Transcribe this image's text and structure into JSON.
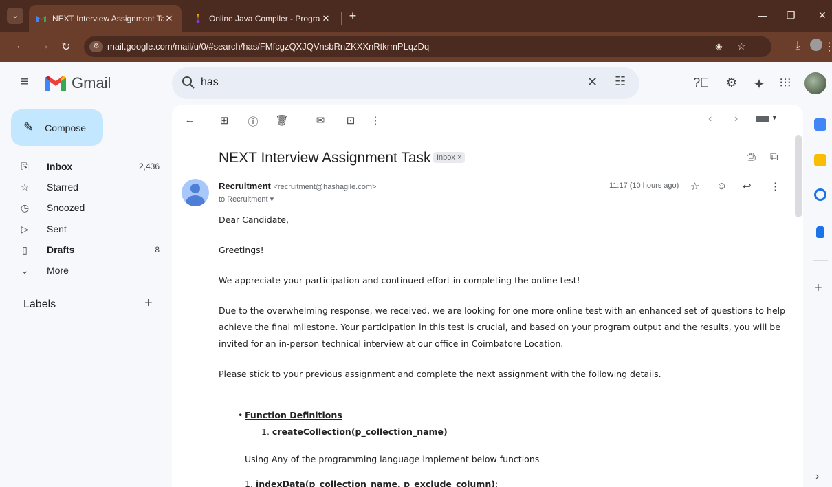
{
  "browser": {
    "tabs": [
      {
        "title": "NEXT Interview Assignment Tas",
        "close": "✕"
      },
      {
        "title": "Online Java Compiler - Program",
        "close": "✕"
      }
    ],
    "new_tab": "+",
    "url": "mail.google.com/mail/u/0/#search/has/FMfcgzQXJQVnsbRnZKXXnRtkrmPLqzDq"
  },
  "gmail": {
    "logo_text": "Gmail",
    "search_query": "has"
  },
  "sidebar": {
    "compose": "Compose",
    "items": [
      {
        "label": "Inbox",
        "count": "2,436",
        "icon": "inbox-icon"
      },
      {
        "label": "Starred",
        "count": "",
        "icon": "star-icon"
      },
      {
        "label": "Snoozed",
        "count": "",
        "icon": "clock-icon"
      },
      {
        "label": "Sent",
        "count": "",
        "icon": "send-icon"
      },
      {
        "label": "Drafts",
        "count": "8",
        "icon": "draft-icon"
      },
      {
        "label": "More",
        "count": "",
        "icon": "chevron-down-icon"
      }
    ],
    "labels_heading": "Labels"
  },
  "email": {
    "subject": "NEXT Interview Assignment Task",
    "label_badge": "Inbox ×",
    "sender_name": "Recruitment",
    "sender_email": "<recruitment@hashagile.com>",
    "to": "to Recruitment ▾",
    "time": "11:17 (10 hours ago)",
    "body": {
      "greeting": "Dear Candidate,",
      "greetings2": "Greetings!",
      "p1": "We appreciate your participation and continued effort in completing the online test!",
      "p2": "Due to the overwhelming response, we received, we are looking for one more online test with an enhanced set of questions to help achieve the final milestone. Your participation in this test is crucial, and based on your program output and the results, you will be invited for an in-person technical interview at our office in Coimbatore Location.",
      "p3": "Please stick to your previous assignment and complete the next assignment with the following details.",
      "function_definitions": "Function Definitions",
      "fn1_num": "1.",
      "fn1": "createCollection(p_collection_name)",
      "p4": "Using Any of the programming language implement below functions",
      "fn2_num": "1.",
      "fn2": "indexData(p_collection_name, p_exclude_column)",
      "fn2_suffix": ":"
    }
  },
  "colors": {
    "compose_bg": "#c2e7ff",
    "search_bg": "#e9eef6",
    "page_bg": "#f6f8fc",
    "browser_frame": "#4b2b1f"
  }
}
